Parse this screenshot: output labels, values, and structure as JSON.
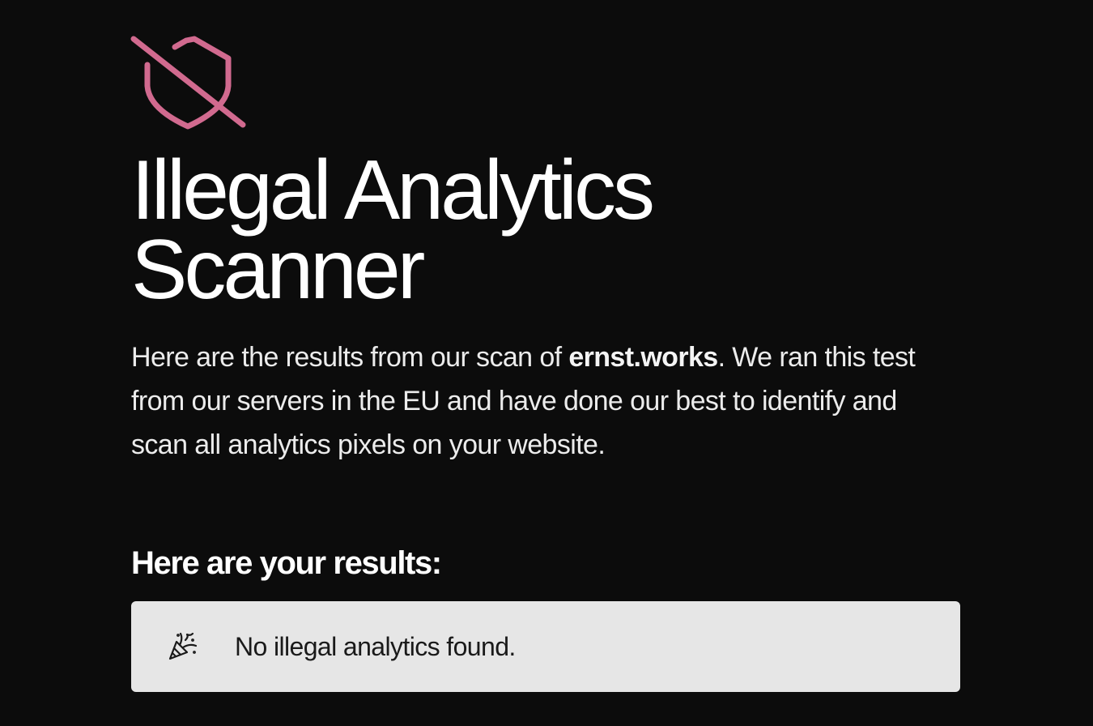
{
  "brand": {
    "logo_icon": "shield-off-icon",
    "accent_color": "#d16a8f"
  },
  "hero": {
    "title_line1": "Illegal Analytics",
    "title_line2": "Scanner",
    "intro_before": "Here are the results from our scan of ",
    "domain": "ernst.works",
    "intro_after": ". We ran this test from our servers in the EU and have done our best to identify and scan all analytics pixels on your website."
  },
  "results": {
    "heading": "Here are your results:",
    "card_icon": "party-popper-icon",
    "message": "No illegal analytics found."
  }
}
